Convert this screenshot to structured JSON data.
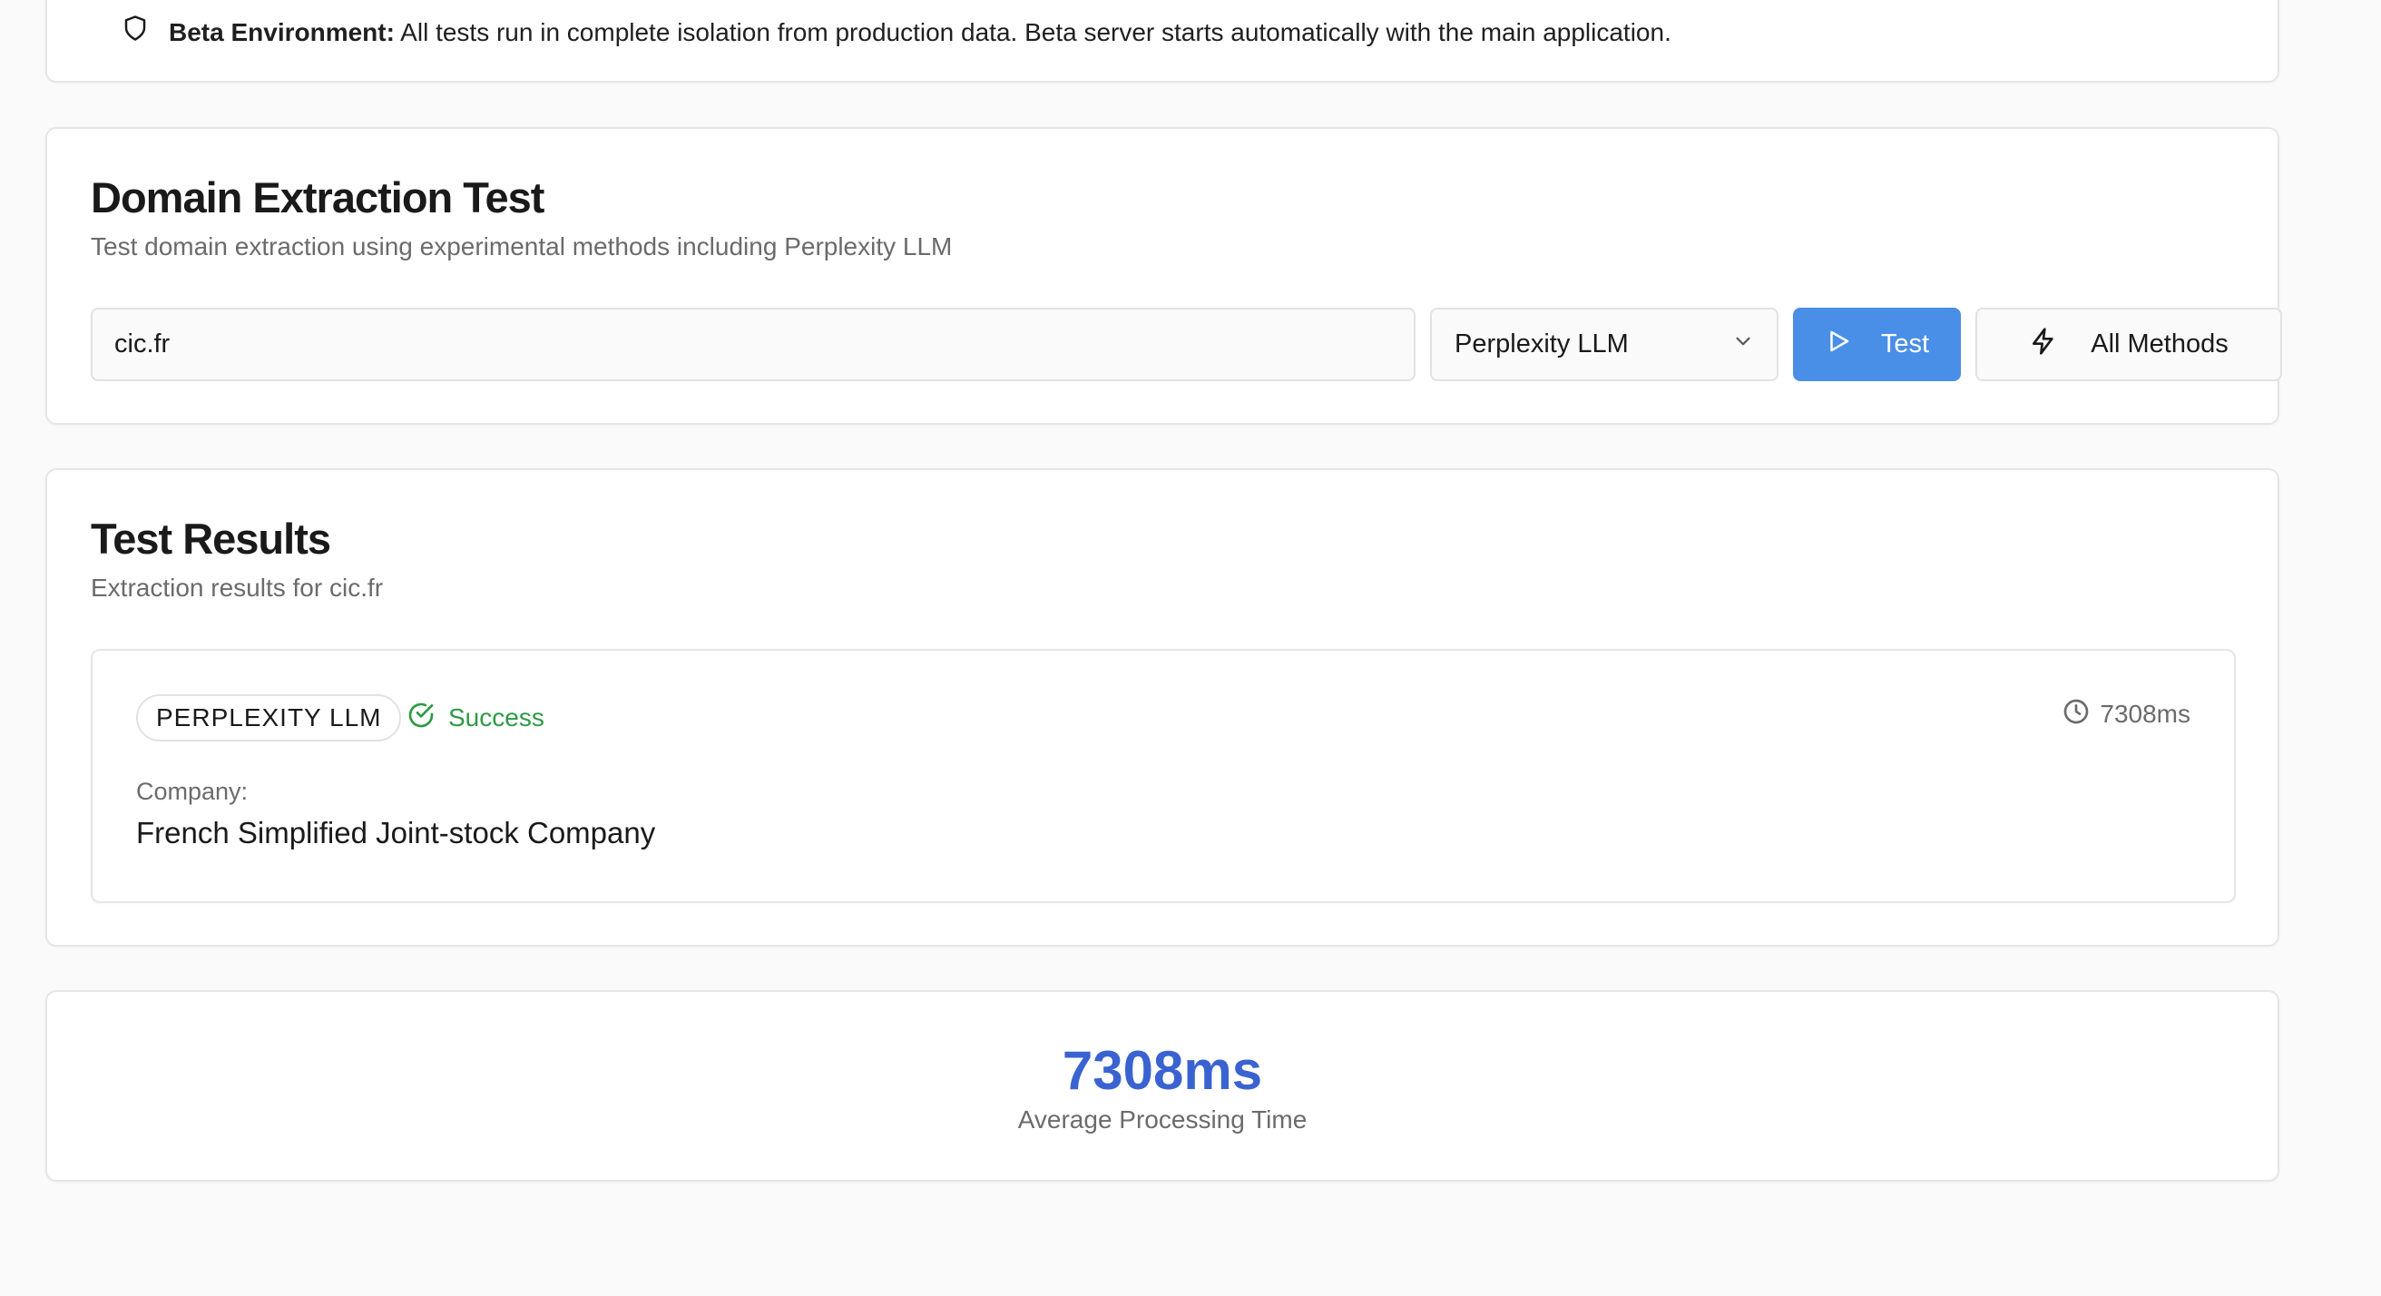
{
  "banner": {
    "title": "Beta Environment:",
    "text": "All tests run in complete isolation from production data. Beta server starts automatically with the main application.",
    "icon": "shield-icon"
  },
  "extraction": {
    "title": "Domain Extraction Test",
    "subtitle": "Test domain extraction using experimental methods including Perplexity LLM",
    "domain_value": "cic.fr",
    "method_selected": "Perplexity LLM",
    "test_label": "Test",
    "all_methods_label": "All Methods"
  },
  "results": {
    "title": "Test Results",
    "subtitle": "Extraction results for cic.fr",
    "items": [
      {
        "method": "PERPLEXITY LLM",
        "status": "Success",
        "time": "7308ms",
        "field_label": "Company:",
        "field_value": "French Simplified Joint-stock Company"
      }
    ]
  },
  "stats": {
    "value": "7308ms",
    "label": "Average Processing Time"
  },
  "colors": {
    "accent": "#4a8fe7",
    "success": "#2e9a46",
    "stat": "#3a63d1"
  }
}
